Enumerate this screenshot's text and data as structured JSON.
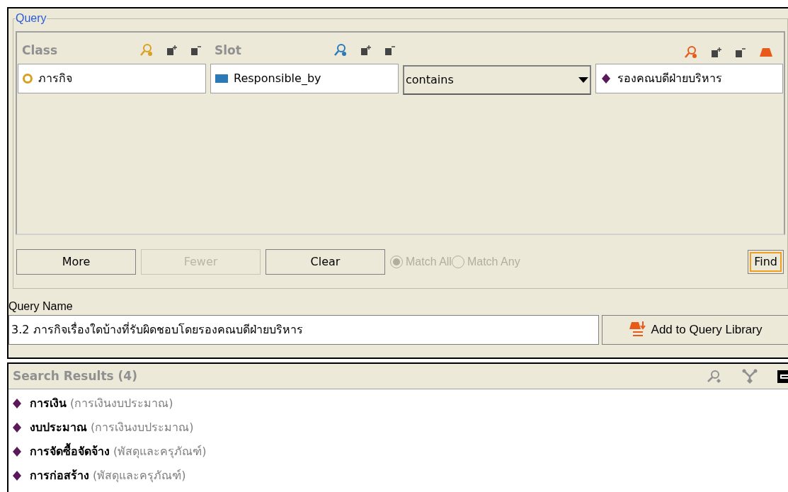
{
  "query": {
    "title": "Query",
    "class_label": "Class",
    "slot_label": "Slot",
    "class_value": "ภารกิจ",
    "slot_value": "Responsible_by",
    "operator": "contains",
    "value": "รองคณบดีฝ่ายบริหาร",
    "buttons": [
      {
        "label": "More",
        "disabled": false
      },
      {
        "label": "Fewer",
        "disabled": true
      },
      {
        "label": "Clear",
        "disabled": false
      }
    ],
    "match_options": [
      {
        "label": "Match All",
        "selected": true,
        "disabled": true
      },
      {
        "label": "Match Any",
        "selected": false,
        "disabled": true
      }
    ],
    "find_button": "Find"
  },
  "query_name": {
    "label": "Query Name",
    "value": "3.2 ภารกิจเรื่องใดบ้างที่รับผิดชอบโดยรองคณบดีฝ่ายบริหาร",
    "add_button": "Add to Query Library"
  },
  "results": {
    "title": "Search Results (4)",
    "items": [
      {
        "name": "การเงิน",
        "class": "(การเงินงบประมาณ)"
      },
      {
        "name": "งบประมาณ",
        "class": "(การเงินงบประมาณ)"
      },
      {
        "name": "การจัดซื้อจัดจ้าง",
        "class": "(พัสดุและครุภัณฑ์)"
      },
      {
        "name": "การก่อสร้าง",
        "class": "(พัสดุและครุภัณฑ์)"
      }
    ]
  }
}
